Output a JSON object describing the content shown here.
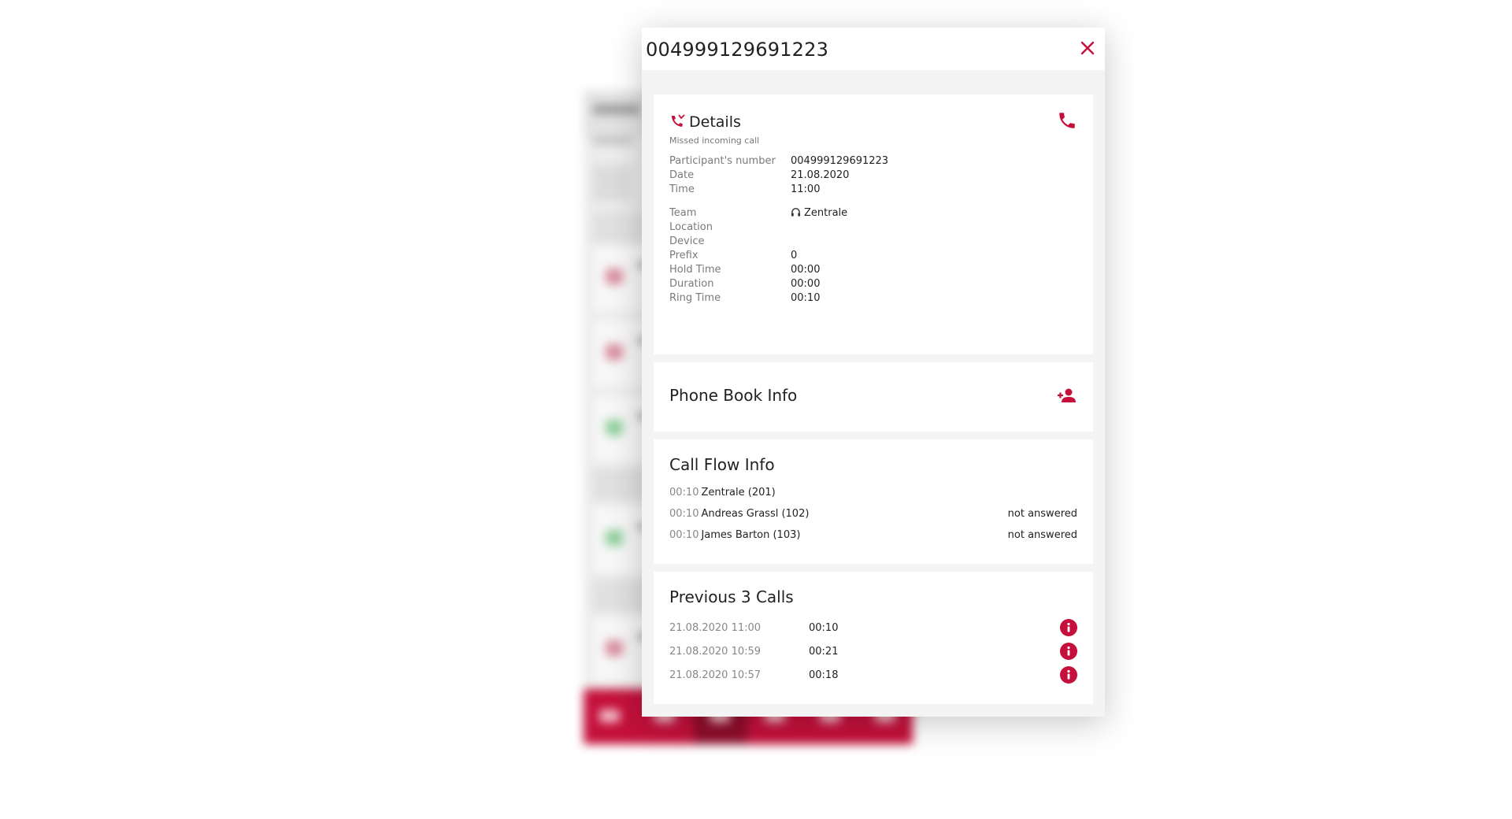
{
  "modal": {
    "title": "004999129691223"
  },
  "details": {
    "title": "Details",
    "subtitle": "Missed incoming call",
    "fields": [
      {
        "label": "Participant's number",
        "value": "004999129691223"
      },
      {
        "label": "Date",
        "value": "21.08.2020"
      },
      {
        "label": "Time",
        "value": "11:00"
      },
      {
        "label": "Team",
        "value": "Zentrale"
      },
      {
        "label": "Location",
        "value": ""
      },
      {
        "label": "Device",
        "value": ""
      },
      {
        "label": "Prefix",
        "value": "0"
      },
      {
        "label": "Hold Time",
        "value": "00:00"
      },
      {
        "label": "Duration",
        "value": "00:00"
      },
      {
        "label": "Ring Time",
        "value": "00:10"
      }
    ]
  },
  "phone_book": {
    "title": "Phone Book Info"
  },
  "call_flow": {
    "title": "Call Flow Info",
    "rows": [
      {
        "time": "00:10",
        "name": "Zentrale (201)",
        "status": ""
      },
      {
        "time": "00:10",
        "name": "Andreas Grassl (102)",
        "status": "not answered"
      },
      {
        "time": "00:10",
        "name": "James Barton (103)",
        "status": "not answered"
      }
    ]
  },
  "previous_calls": {
    "title": "Previous 3 Calls",
    "rows": [
      {
        "datetime": "21.08.2020 11:00",
        "duration": "00:10"
      },
      {
        "datetime": "21.08.2020 10:59",
        "duration": "00:21"
      },
      {
        "datetime": "21.08.2020 10:57",
        "duration": "00:18"
      }
    ]
  },
  "colors": {
    "accent": "#c4103b",
    "panel_background": "#f4f4f4",
    "label_text": "#7a7a7a"
  },
  "icons": {
    "details": "missed-call-icon",
    "call": "phone-icon",
    "team": "headset-icon",
    "add_contact": "add-contact-icon",
    "close": "close-icon",
    "info": "info-icon"
  }
}
